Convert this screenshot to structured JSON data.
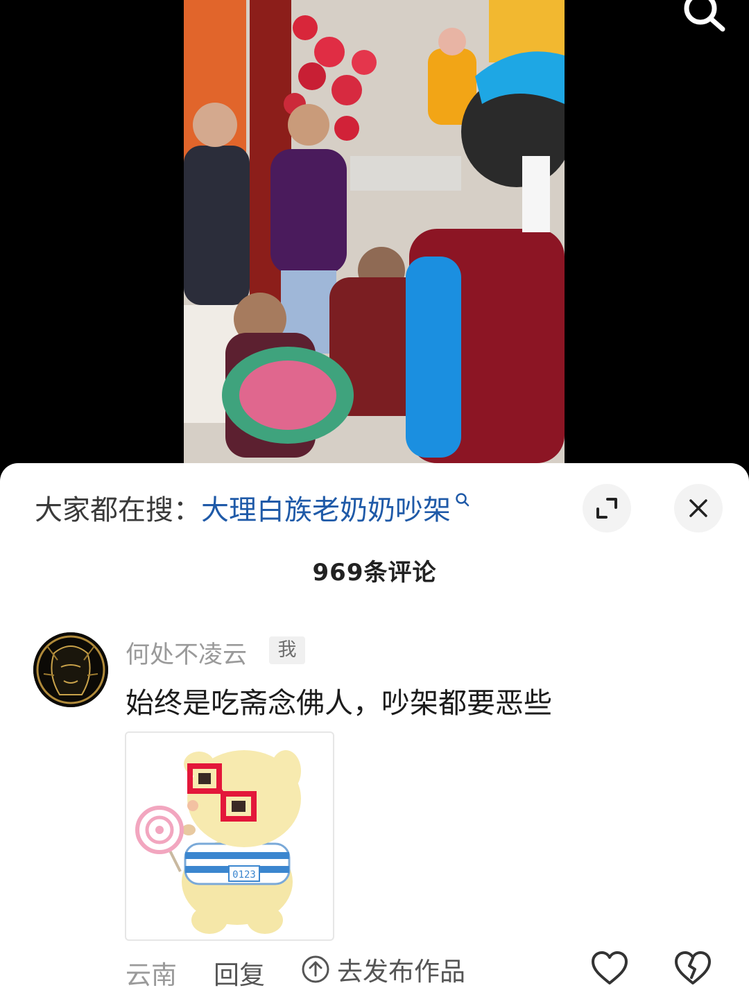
{
  "search_hint": {
    "prefix": "大家都在搜：",
    "keyword": "大理白族老奶奶吵架"
  },
  "comments_header": {
    "count_label": "969条评论"
  },
  "comment": {
    "username": "何处不凌云",
    "badge": "我",
    "text": "始终是吃斋念佛人，吵架都要恶些",
    "location": "云南",
    "reply_label": "回复",
    "publish_label": "去发布作品"
  },
  "sticker": {
    "shirt_text": "0123"
  },
  "colors": {
    "keyword": "#1f5aa8",
    "sheet_bg": "#ffffff",
    "video_bg": "#000000"
  }
}
